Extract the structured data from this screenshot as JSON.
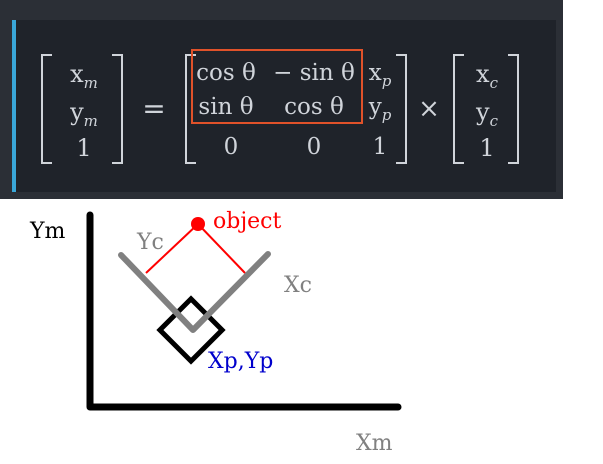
{
  "equation": {
    "lhs": [
      "x_m",
      "y_m",
      "1"
    ],
    "lhs_display": [
      [
        "x",
        "m"
      ],
      [
        "y",
        "m"
      ],
      [
        "1",
        ""
      ]
    ],
    "equals": "=",
    "times": "×",
    "matrix": [
      [
        "cos θ",
        "− sin θ",
        "x_p"
      ],
      [
        "sin θ",
        "cos θ",
        "y_p"
      ],
      [
        "0",
        "0",
        "1"
      ]
    ],
    "matrix_display": [
      [
        [
          "cos θ",
          ""
        ],
        [
          "− sin θ",
          ""
        ],
        [
          "x",
          "p"
        ]
      ],
      [
        [
          "sin θ",
          ""
        ],
        [
          "cos θ",
          ""
        ],
        [
          "y",
          "p"
        ]
      ],
      [
        [
          "0",
          ""
        ],
        [
          "0",
          ""
        ],
        [
          "1",
          ""
        ]
      ]
    ],
    "rhs": [
      "x_c",
      "y_c",
      "1"
    ],
    "rhs_display": [
      [
        "x",
        "c"
      ],
      [
        "y",
        "c"
      ],
      [
        "1",
        ""
      ]
    ],
    "highlight_color": "#e0522a"
  },
  "diagram": {
    "labels": {
      "ym": "Ym",
      "xm": "Xm",
      "yc": "Yc",
      "xc": "Xc",
      "object": "object",
      "xpyp": "Xp,Yp"
    },
    "colors": {
      "axes": "#000000",
      "camera_axes": "#808080",
      "object": "#ff0000",
      "robot_label": "#0000cc",
      "equation_text": "#d0d4da",
      "panel_bg": "#1f232a",
      "accent": "#3aa7d8"
    }
  }
}
